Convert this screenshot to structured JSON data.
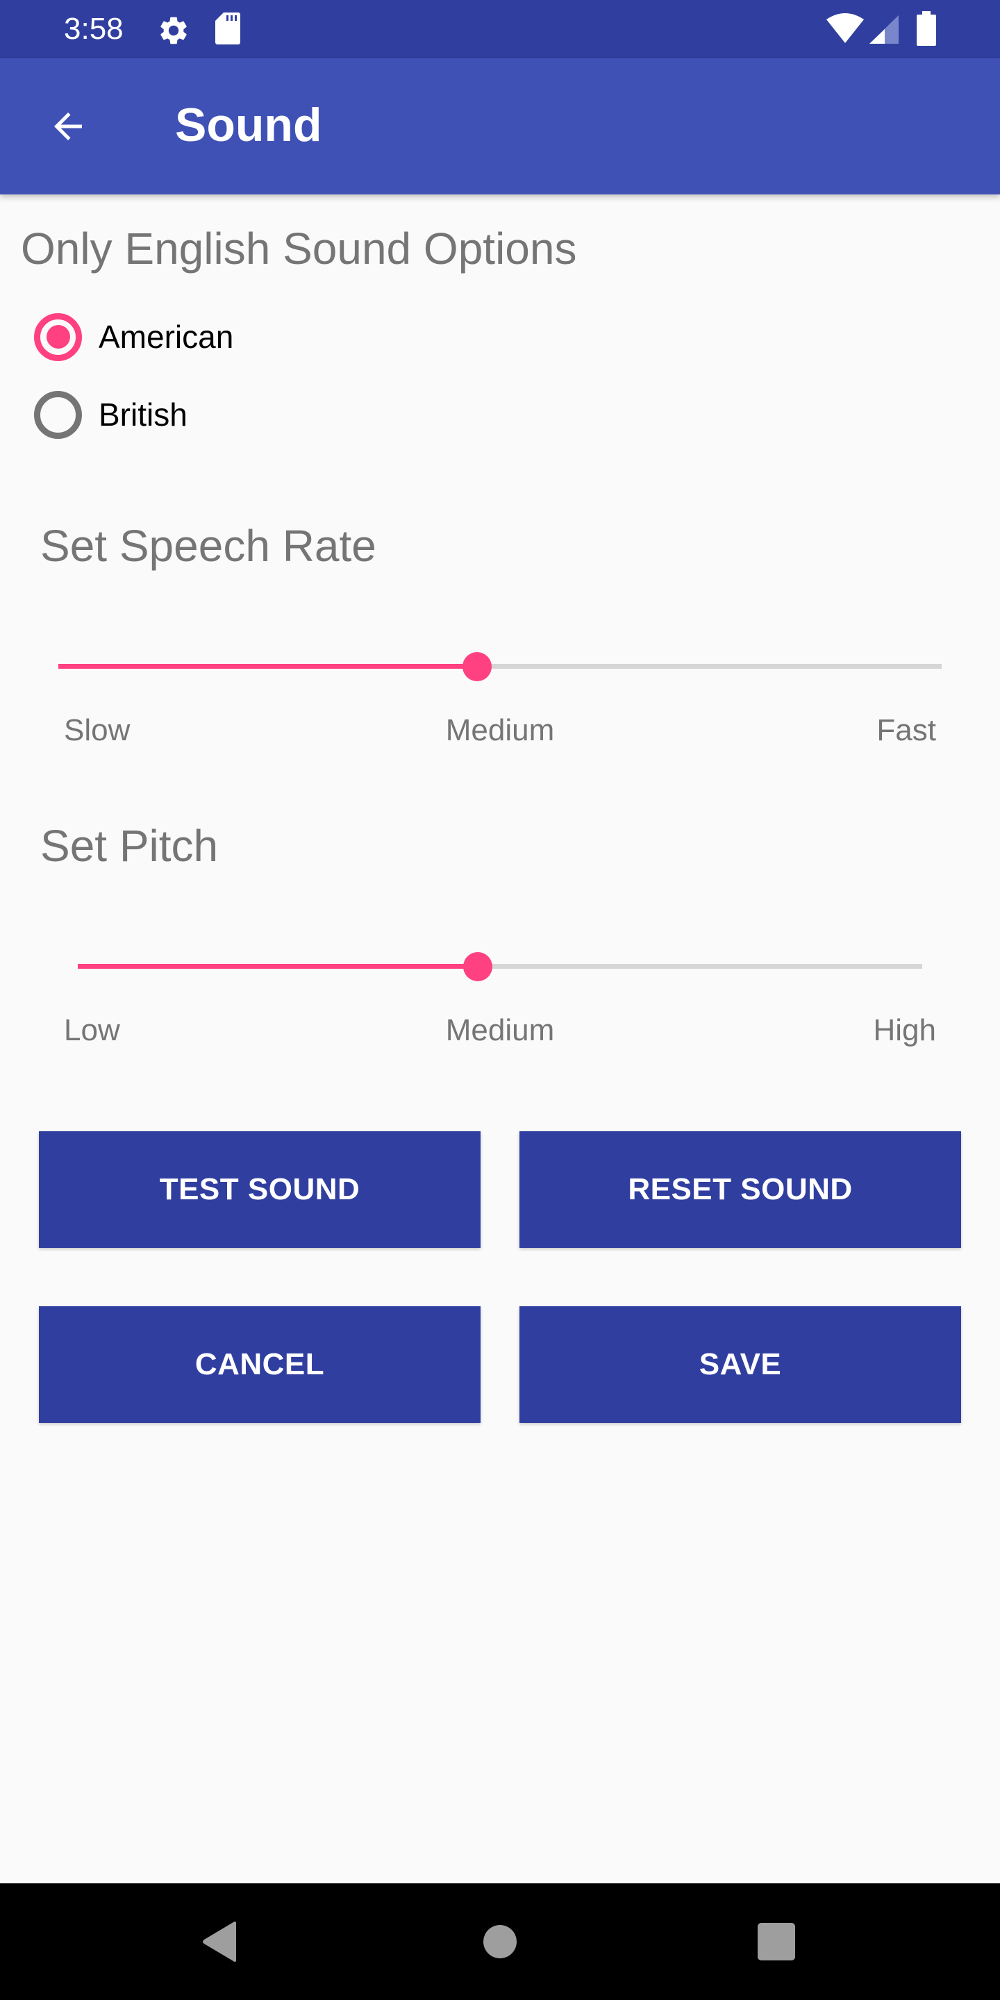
{
  "status_bar": {
    "time": "3:58",
    "left_icons": [
      "settings-gear-icon",
      "sd-card-icon"
    ],
    "right_icons": [
      "wifi-icon",
      "cell-signal-icon",
      "battery-icon"
    ]
  },
  "app_bar": {
    "title": "Sound",
    "back_icon": "arrow-back-icon"
  },
  "sound_options": {
    "title": "Only English Sound Options",
    "options": [
      {
        "label": "American",
        "selected": true
      },
      {
        "label": "British",
        "selected": false
      }
    ]
  },
  "speech_rate": {
    "title": "Set Speech Rate",
    "value_fraction": 0.474,
    "labels": {
      "low": "Slow",
      "mid": "Medium",
      "high": "Fast"
    }
  },
  "pitch": {
    "title": "Set Pitch",
    "value_fraction": 0.474,
    "labels": {
      "low": "Low",
      "mid": "Medium",
      "high": "High"
    }
  },
  "buttons": {
    "test_sound": "TEST SOUND",
    "reset_sound": "RESET SOUND",
    "cancel": "CANCEL",
    "save": "SAVE"
  },
  "nav_bar": {
    "icons": [
      "nav-back-icon",
      "nav-home-icon",
      "nav-recents-icon"
    ]
  },
  "colors": {
    "status_bar": "#303f9f",
    "app_bar": "#3f51b5",
    "accent": "#ff4081",
    "button": "#303f9f",
    "secondary_text": "#757575",
    "track_inactive": "#d6d6d6",
    "background": "#fafafa"
  }
}
